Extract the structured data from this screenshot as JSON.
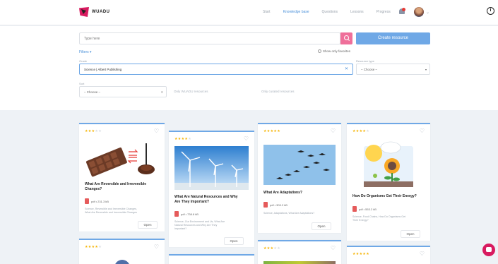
{
  "brand": {
    "name": "WUADU",
    "color": "#d81b60"
  },
  "nav": [
    "Start",
    "Knowledge base",
    "Questions",
    "Lessons",
    "Progress"
  ],
  "nav_active": 1,
  "search": {
    "placeholder": "Type here"
  },
  "create_label": "Create resource",
  "filters_label": "Filters ▾",
  "fav_label": "Show only favorites",
  "grade_label": "Grade",
  "grade_value": "Science | Albert Publishing",
  "resource_type_label": "Resource type",
  "resource_type_value": "– Choose –",
  "sort_label": "Sort",
  "sort_value": "– Choose –",
  "toggle_wuadu": "Only WUADU resources",
  "toggle_curated": "Only curated resources",
  "accent": "#6fa8e6",
  "cards": [
    {
      "stars": 3,
      "title_l1": "What Are Reversible and Irreversible",
      "title_l2": "Changes?",
      "file": "pdf  •  231.3 kB",
      "tags_l1": "Science, Reversible and Irreversible Changes,",
      "tags_l2": "What Are Reversible and Irreversible Changes",
      "open": "Open"
    },
    {
      "stars": 4,
      "title_l1": "What Are Natural Resources and Why",
      "title_l2": "Are They Important?",
      "file": "pdf  •  738.8 kB",
      "tags_l1": "Science, Our Environment and Us, What Are",
      "tags_l2": "Natural Resources and Why Are They",
      "tags_l3": "Important?",
      "open": "Open"
    },
    {
      "stars": 5,
      "title_l1": "What Are Adaptations?",
      "file": "pdf  •  309.2 kB",
      "tags_l1": "Science, Adaptations, What Are Adaptations?",
      "open": "Open"
    },
    {
      "stars": 4,
      "title_l1": "How Do Organisms Get Their Energy?",
      "file": "pdf  •  553.2 kB",
      "tags_l1": "Science, Food Chains, How Do Organisms Get",
      "tags_l2": "Their Energy?",
      "open": "Open"
    },
    {
      "stars": 4
    },
    {
      "stars": 3
    },
    {
      "stars": 5
    }
  ]
}
